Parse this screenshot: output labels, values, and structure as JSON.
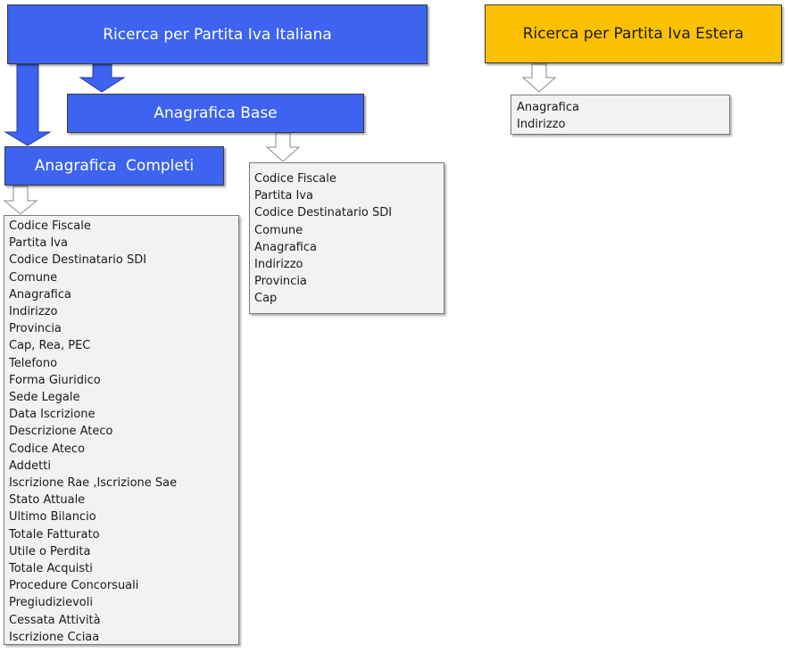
{
  "boxes": {
    "italiana": "Ricerca per Partita Iva Italiana",
    "estera": "Ricerca per Partita Iva Estera",
    "base": "Anagrafica Base",
    "completi": "Anagrafica  Completi"
  },
  "lists": {
    "estera": [
      "Anagrafica",
      "Indirizzo"
    ],
    "base": [
      "Codice Fiscale",
      "Partita Iva",
      "Codice Destinatario SDI",
      "Comune",
      "Anagrafica",
      "Indirizzo",
      "Provincia",
      "Cap"
    ],
    "completi": [
      "Codice Fiscale",
      "Partita Iva",
      "Codice Destinatario SDI",
      "Comune",
      "Anagrafica",
      "Indirizzo",
      "Provincia",
      "Cap, Rea, PEC",
      "Telefono",
      "Forma Giuridico",
      "Sede Legale",
      "Data Iscrizione",
      "Descrizione Ateco",
      "Codice Ateco",
      "Addetti",
      "Iscrizione Rae ,Iscrizione Sae",
      "Stato Attuale",
      "Ultimo Bilancio",
      "Totale Fatturato",
      "Utile o Perdita",
      "Totale Acquisti",
      "Procedure Concorsuali",
      "Pregiudizievoli",
      "Cessata Attività",
      "Iscrizione Cciaa"
    ]
  },
  "colors": {
    "blue_box": "#3d63f0",
    "gold_box": "#fcc100",
    "list_bg": "#f2f2f2"
  }
}
